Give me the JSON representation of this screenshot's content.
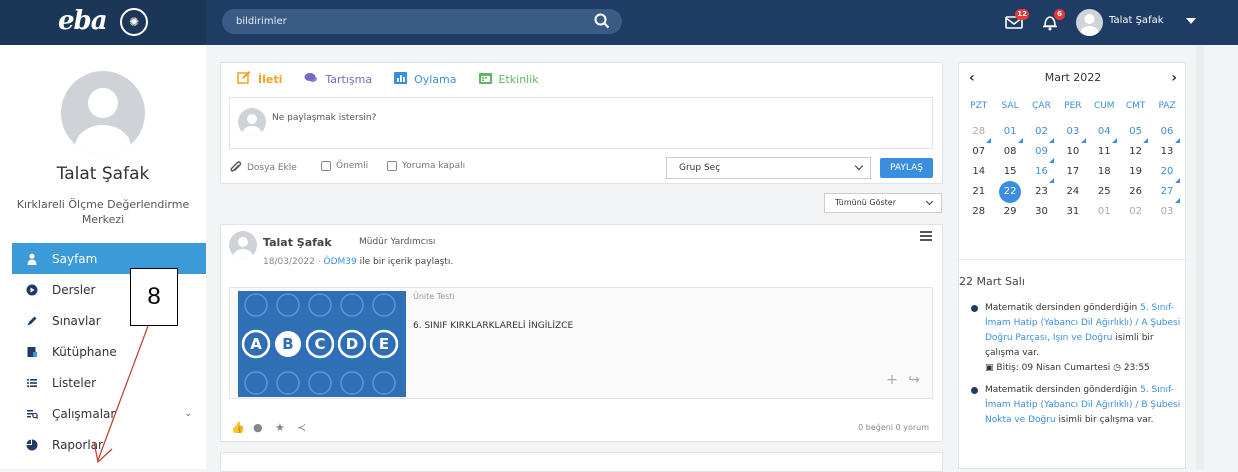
{
  "header": {
    "logo_text": "eba",
    "search_placeholder": "bildirimler",
    "messages_count": "12",
    "notifications_count": "6",
    "user_name": "Talat Şafak"
  },
  "sidebar": {
    "profile_name": "Talat Şafak",
    "profile_org": "Kırklareli Ölçme Değerlendirme Merkezi",
    "items": [
      {
        "label": "Sayfam",
        "icon": "user-icon",
        "active": true
      },
      {
        "label": "Dersler",
        "icon": "play-circle-icon"
      },
      {
        "label": "Sınavlar",
        "icon": "pencil-icon"
      },
      {
        "label": "Kütüphane",
        "icon": "library-icon"
      },
      {
        "label": "Listeler",
        "icon": "list-icon"
      },
      {
        "label": "Çalışmalar",
        "icon": "tasks-icon",
        "has_submenu": true
      },
      {
        "label": "Raporlar",
        "icon": "pie-chart-icon"
      }
    ]
  },
  "annotation": {
    "label": "8"
  },
  "composer": {
    "tabs": [
      {
        "label": "İleti",
        "icon": "edit-icon",
        "color": "#f0a31c"
      },
      {
        "label": "Tartışma",
        "icon": "comments-icon",
        "color": "#7b68c9"
      },
      {
        "label": "Oylama",
        "icon": "bar-chart-icon",
        "color": "#3b8ede"
      },
      {
        "label": "Etkinlik",
        "icon": "calendar-icon",
        "color": "#5cb85c"
      }
    ],
    "placeholder": "Ne paylaşmak istersin?",
    "attach_label": "Dosya Ekle",
    "important_label": "Önemli",
    "comments_closed_label": "Yoruma kapalı",
    "group_select": "Grup Seç",
    "share_button": "PAYLAŞ"
  },
  "feed_filter": "Tümünü Göster",
  "post": {
    "author": "Talat Şafak",
    "role": "Müdür Yardımcısı",
    "date": "18/03/2022",
    "group": "ÖDM39",
    "action_text": "ile bir içerik paylaştı.",
    "card_label": "Ünite Testi",
    "card_title": "6. SINIF KIRKLARKLARELİ İNGİLİZCE",
    "stats": "0 beğeni  0 yorum"
  },
  "calendar": {
    "month": "Mart 2022",
    "day_names": [
      "PZT",
      "SAL",
      "ÇAR",
      "PER",
      "CUM",
      "CMT",
      "PAZ"
    ],
    "weeks": [
      [
        "28",
        "01",
        "02",
        "03",
        "04",
        "05",
        "06"
      ],
      [
        "07",
        "08",
        "09",
        "10",
        "11",
        "12",
        "13"
      ],
      [
        "14",
        "15",
        "16",
        "17",
        "18",
        "19",
        "20"
      ],
      [
        "21",
        "22",
        "23",
        "24",
        "25",
        "26",
        "27"
      ],
      [
        "28",
        "29",
        "30",
        "31",
        "01",
        "02",
        "03"
      ]
    ],
    "selected_date_label": "22 Mart Salı",
    "events": [
      {
        "prefix": "Matematik dersinden gönderdiğin ",
        "link": "5. Sınıf-İmam Hatip (Yabancı Dil Ağırlıklı) / A Şubesi Doğru Parçası, Işın ve Doğru",
        "suffix": " isimli bir çalışma var.",
        "due": "Bitiş: 09 Nisan Cumartesi",
        "time": "23:55"
      },
      {
        "prefix": "Matematik dersinden gönderdiğin ",
        "link": "5. Sınıf-İmam Hatip (Yabancı Dil Ağırlıklı) / B Şubesi Nokta ve Doğru",
        "suffix": " isimli bir çalışma var."
      }
    ]
  }
}
